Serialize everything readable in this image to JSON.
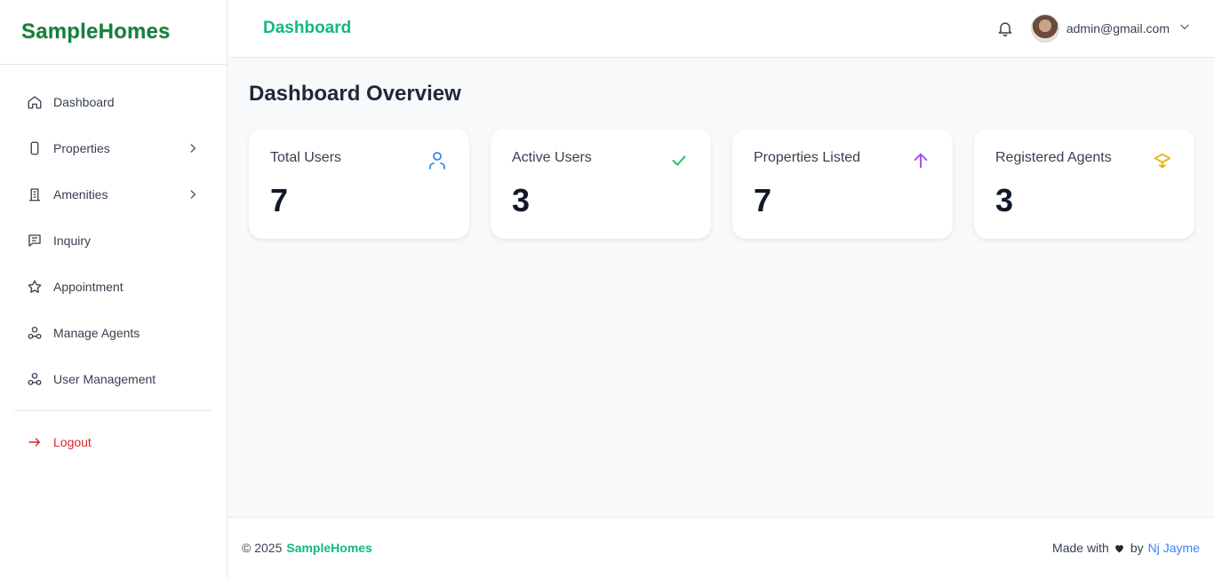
{
  "brand": {
    "name": "SampleHomes",
    "color": "#15803d"
  },
  "sidebar": {
    "items": [
      {
        "label": "Dashboard",
        "icon": "home-icon",
        "has_submenu": false
      },
      {
        "label": "Properties",
        "icon": "phone-icon",
        "has_submenu": true
      },
      {
        "label": "Amenities",
        "icon": "building-icon",
        "has_submenu": true
      },
      {
        "label": "Inquiry",
        "icon": "message-icon",
        "has_submenu": false
      },
      {
        "label": "Appointment",
        "icon": "star-icon",
        "has_submenu": false
      },
      {
        "label": "Manage Agents",
        "icon": "users-icon",
        "has_submenu": false
      },
      {
        "label": "User Management",
        "icon": "users-icon",
        "has_submenu": false
      }
    ],
    "logout": {
      "label": "Logout",
      "icon": "arrow-right-icon",
      "color": "#dc2626"
    }
  },
  "header": {
    "title": "Dashboard",
    "title_color": "#10b981",
    "user_email": "admin@gmail.com"
  },
  "main": {
    "page_title": "Dashboard Overview",
    "cards": [
      {
        "label": "Total Users",
        "value": "7",
        "icon": "user-icon",
        "icon_color": "#3b82f6"
      },
      {
        "label": "Active Users",
        "value": "3",
        "icon": "check-icon",
        "icon_color": "#22c55e"
      },
      {
        "label": "Properties Listed",
        "value": "7",
        "icon": "arrow-up-icon",
        "icon_color": "#a855f7"
      },
      {
        "label": "Registered Agents",
        "value": "3",
        "icon": "layers-icon",
        "icon_color": "#eab308"
      }
    ]
  },
  "footer": {
    "copyright": "© 2025",
    "brand": "SampleHomes",
    "made_with": "Made with",
    "by": "by",
    "author": "Nj Jayme"
  }
}
